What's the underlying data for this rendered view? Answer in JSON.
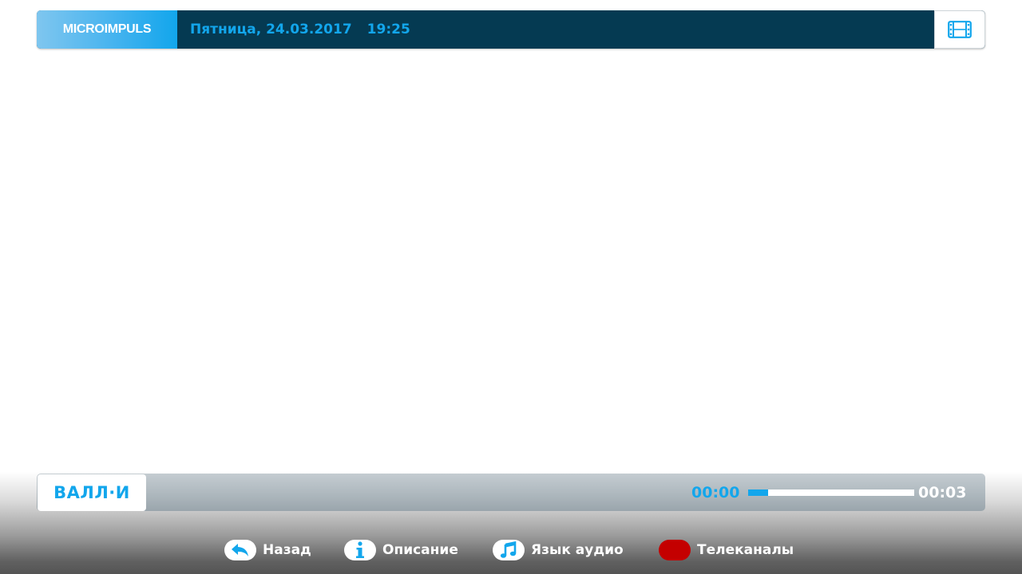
{
  "header": {
    "logo_text": "MICROIMPULS",
    "date": "Пятница, 24.03.2017",
    "time": "19:25",
    "film_icon": "film-strip-icon"
  },
  "player": {
    "channel_name": "ВАЛЛ·И",
    "current_time": "00:00",
    "total_time": "00:03",
    "progress": 0.12
  },
  "hints": [
    {
      "icon": "back-arrow-icon",
      "label": "Назад"
    },
    {
      "icon": "info-icon",
      "label": "Описание"
    },
    {
      "icon": "music-note-icon",
      "label": "Язык аудио"
    },
    {
      "icon": "red-button-icon",
      "label": "Телеканалы",
      "color": "#c40000"
    }
  ],
  "colors": {
    "accent": "#12a6ec",
    "header_bg": "#053a52",
    "red_key": "#c40000"
  }
}
